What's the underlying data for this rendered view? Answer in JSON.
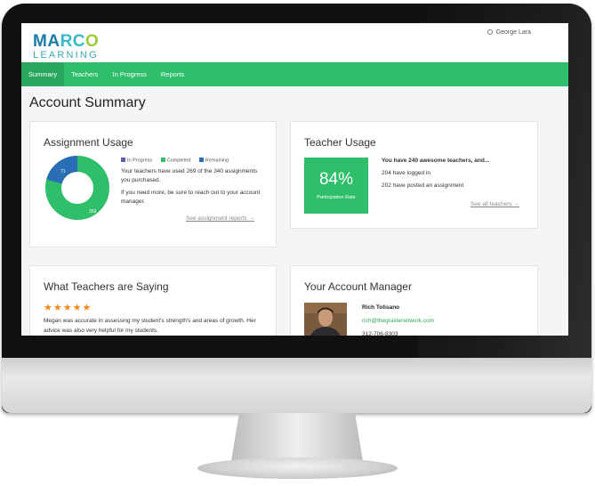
{
  "app": {
    "logo_line1": "MARCO",
    "logo_line2": "LEARNING",
    "user_name": "George Lara"
  },
  "nav": {
    "items": [
      {
        "label": "Summary",
        "active": true
      },
      {
        "label": "Teachers",
        "active": false
      },
      {
        "label": "In Progress",
        "active": false
      },
      {
        "label": "Reports",
        "active": false
      }
    ]
  },
  "page": {
    "title": "Account Summary"
  },
  "assignment_usage": {
    "title": "Assignment Usage",
    "legend": [
      {
        "label": "In Progress",
        "color": "#5b5ea8"
      },
      {
        "label": "Completed",
        "color": "#2fbe6a"
      },
      {
        "label": "Remaining",
        "color": "#2a6fb5"
      }
    ],
    "donut": {
      "in_progress": 0,
      "completed": 269,
      "remaining": 71,
      "completed_label": "269",
      "remaining_label": "71"
    },
    "text1": "Your teachers have used 269 of the 340 assignments you purchased.",
    "text2": "If you need more, be sure to reach out to your account manager.",
    "link": "See assignment reports →"
  },
  "teacher_usage": {
    "title": "Teacher Usage",
    "rate_value": "84%",
    "rate_label": "Participation Rate",
    "headline": "You have 240 awesome teachers, and...",
    "logged_in": "204 have logged in",
    "posted": "202 have posted an assignment",
    "link": "See all teachers →"
  },
  "testimonials": {
    "title": "What Teachers are Saying",
    "rating": 5,
    "stars": "★★★★★",
    "quote": "Megan was accurate in assessing my student's strength's and areas of growth. Her advice was also very helpful for my students."
  },
  "account_manager": {
    "title": "Your Account Manager",
    "name": "Rich Tolisano",
    "email": "rich@thegraidenetwork.com",
    "phone": "312-706-8303"
  },
  "colors": {
    "brand_green": "#2fbe6a",
    "brand_blue": "#2a6fb5",
    "star_orange": "#f1881e"
  }
}
